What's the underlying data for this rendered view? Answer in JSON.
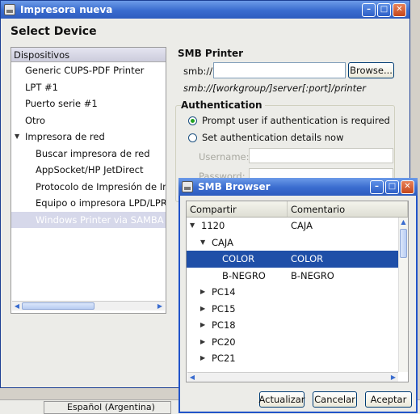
{
  "main_window": {
    "title": "Impresora nueva",
    "heading": "Select Device",
    "device_list": {
      "header": "Dispositivos",
      "items": [
        {
          "label": "Generic CUPS-PDF Printer"
        },
        {
          "label": "LPT #1"
        },
        {
          "label": "Puerto serie #1"
        },
        {
          "label": "Otro"
        },
        {
          "label": "Impresora de red",
          "expanded": true
        },
        {
          "label": "Buscar impresora de red"
        },
        {
          "label": "AppSocket/HP JetDirect"
        },
        {
          "label": "Protocolo de Impresión de Internet (IPP)"
        },
        {
          "label": "Equipo o impresora LPD/LPR"
        },
        {
          "label": "Windows Printer via SAMBA",
          "selected": true
        }
      ]
    },
    "smb": {
      "title": "SMB Printer",
      "label": "smb://",
      "value": "",
      "browse": "Browse...",
      "hint": "smb://[workgroup/]server[:port]/printer"
    },
    "auth": {
      "title": "Authentication",
      "option_prompt": "Prompt user if authentication is required",
      "option_set": "Set authentication details now",
      "username_label": "Username:",
      "password_label": "Password:",
      "selected": "prompt"
    },
    "status": {
      "language": "Español (Argentina)"
    }
  },
  "smb_browser": {
    "title": "SMB Browser",
    "columns": [
      "Compartir",
      "Comentario"
    ],
    "rows": [
      {
        "name": "1120",
        "comment": "CAJA",
        "level": 0,
        "expander": "open"
      },
      {
        "name": "CAJA",
        "comment": "",
        "level": 1,
        "expander": "open"
      },
      {
        "name": "COLOR",
        "comment": "COLOR",
        "level": 2,
        "expander": "",
        "selected": true
      },
      {
        "name": "B-NEGRO",
        "comment": "B-NEGRO",
        "level": 2,
        "expander": ""
      },
      {
        "name": "PC14",
        "comment": "",
        "level": 1,
        "expander": "closed"
      },
      {
        "name": "PC15",
        "comment": "",
        "level": 1,
        "expander": "closed"
      },
      {
        "name": "PC18",
        "comment": "",
        "level": 1,
        "expander": "closed"
      },
      {
        "name": "PC20",
        "comment": "",
        "level": 1,
        "expander": "closed"
      },
      {
        "name": "PC21",
        "comment": "",
        "level": 1,
        "expander": "closed"
      }
    ],
    "buttons": {
      "refresh": "Actualizar",
      "cancel": "Cancelar",
      "accept": "Aceptar"
    }
  }
}
